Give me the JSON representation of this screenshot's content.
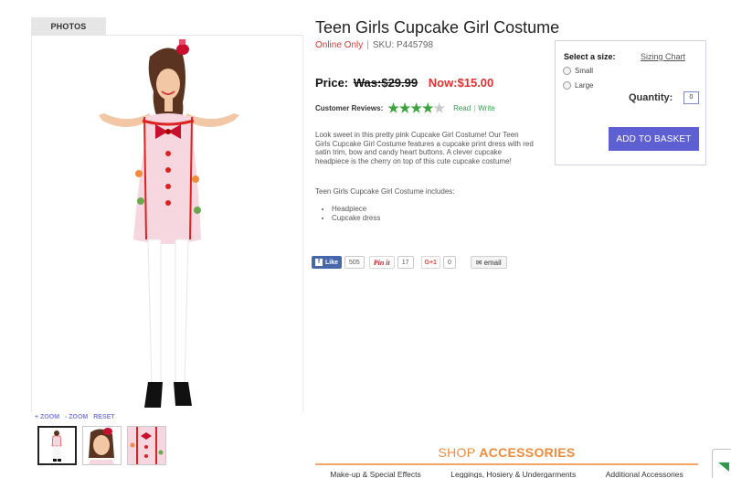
{
  "photos": {
    "tab_label": "PHOTOS",
    "zoom_controls": [
      "+ ZOOM",
      "- ZOOM",
      "RESET"
    ],
    "thumbnails": [
      "thumbnail-full-body",
      "thumbnail-headshot",
      "thumbnail-dress-detail"
    ]
  },
  "product": {
    "title": "Teen Girls Cupcake Girl Costume",
    "availability": "Online Only",
    "separator": "|",
    "sku": "SKU: P445798",
    "price_label": "Price:",
    "was_price": "Was:$29.99",
    "now_price": "Now:$15.00",
    "reviews_label": "Customer Reviews:",
    "rating": 4,
    "rating_max": 5,
    "read_link": "Read",
    "review_divider": "|",
    "write_link": "Write",
    "description": "Look sweet in this pretty pink Cupcake Girl Costume! Our Teen Girls Cupcake Girl Costume features a cupcake print dress with red satin trim, bow and candy heart buttons. A clever cupcake headpiece is the cherry on top of this cute cupcake costume!",
    "includes_label": "Teen Girls Cupcake Girl Costume includes:",
    "includes": [
      "Headpiece",
      "Cupcake dress"
    ]
  },
  "purchase": {
    "select_size_label": "Select a size:",
    "sizing_chart_link": "Sizing Chart",
    "sizes": [
      "Small",
      "Large"
    ],
    "quantity_label": "Quantity:",
    "quantity_value": "0",
    "add_button": "ADD TO BASKET"
  },
  "social": {
    "like_label": "Like",
    "like_count": "505",
    "pin_label": "Pin it",
    "pin_count": "17",
    "gplus_label": "G+1",
    "gplus_count": "0",
    "email_label": "email"
  },
  "accessories": {
    "heading_light": "SHOP",
    "heading_bold": "ACCESSORIES",
    "tabs": [
      "Make-up & Special Effects",
      "Leggings, Hosiery & Undergarments",
      "Additional Accessories"
    ]
  },
  "colors": {
    "accent_button": "#5e5fd1",
    "sale_red": "#e03030",
    "review_green": "#3aa33a",
    "accessories_orange": "#f08b3c"
  }
}
